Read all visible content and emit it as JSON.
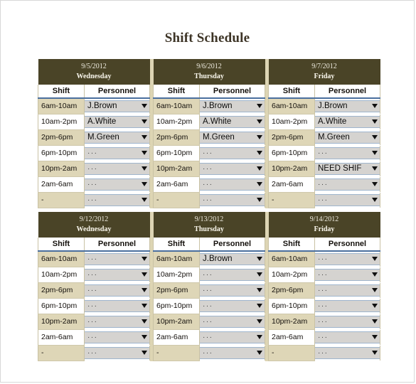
{
  "page": {
    "title": "Shift Schedule"
  },
  "columns": {
    "shift_label": "Shift",
    "personnel_label": "Personnel"
  },
  "empty_value": "···",
  "shift_slots": [
    "6am-10am",
    "10am-2pm",
    "2pm-6pm",
    "6pm-10pm",
    "10pm-2am",
    "2am-6am",
    "-"
  ],
  "weeks": [
    {
      "days": [
        {
          "date": "9/5/2012",
          "weekday": "Wednesday",
          "rows": [
            {
              "shift": "6am-10am",
              "personnel": "J.Brown"
            },
            {
              "shift": "10am-2pm",
              "personnel": "A.White"
            },
            {
              "shift": "2pm-6pm",
              "personnel": "M.Green"
            },
            {
              "shift": "6pm-10pm",
              "personnel": "···"
            },
            {
              "shift": "10pm-2am",
              "personnel": "···"
            },
            {
              "shift": "2am-6am",
              "personnel": "···"
            },
            {
              "shift": "-",
              "personnel": "···"
            }
          ]
        },
        {
          "date": "9/6/2012",
          "weekday": "Thursday",
          "rows": [
            {
              "shift": "6am-10am",
              "personnel": "J.Brown"
            },
            {
              "shift": "10am-2pm",
              "personnel": "A.White"
            },
            {
              "shift": "2pm-6pm",
              "personnel": "M.Green"
            },
            {
              "shift": "6pm-10pm",
              "personnel": "···"
            },
            {
              "shift": "10pm-2am",
              "personnel": "···"
            },
            {
              "shift": "2am-6am",
              "personnel": "···"
            },
            {
              "shift": "-",
              "personnel": "···"
            }
          ]
        },
        {
          "date": "9/7/2012",
          "weekday": "Friday",
          "rows": [
            {
              "shift": "6am-10am",
              "personnel": "J.Brown"
            },
            {
              "shift": "10am-2pm",
              "personnel": "A.White"
            },
            {
              "shift": "2pm-6pm",
              "personnel": "M.Green"
            },
            {
              "shift": "6pm-10pm",
              "personnel": "···"
            },
            {
              "shift": "10pm-2am",
              "personnel": "NEED SHIF"
            },
            {
              "shift": "2am-6am",
              "personnel": "···"
            },
            {
              "shift": "-",
              "personnel": "···"
            }
          ]
        }
      ]
    },
    {
      "days": [
        {
          "date": "9/12/2012",
          "weekday": "Wednesday",
          "rows": [
            {
              "shift": "6am-10am",
              "personnel": "···"
            },
            {
              "shift": "10am-2pm",
              "personnel": "···"
            },
            {
              "shift": "2pm-6pm",
              "personnel": "···"
            },
            {
              "shift": "6pm-10pm",
              "personnel": "···"
            },
            {
              "shift": "10pm-2am",
              "personnel": "···"
            },
            {
              "shift": "2am-6am",
              "personnel": "···"
            },
            {
              "shift": "-",
              "personnel": "···"
            }
          ]
        },
        {
          "date": "9/13/2012",
          "weekday": "Thursday",
          "rows": [
            {
              "shift": "6am-10am",
              "personnel": "J.Brown"
            },
            {
              "shift": "10am-2pm",
              "personnel": "···"
            },
            {
              "shift": "2pm-6pm",
              "personnel": "···"
            },
            {
              "shift": "6pm-10pm",
              "personnel": "···"
            },
            {
              "shift": "10pm-2am",
              "personnel": "···"
            },
            {
              "shift": "2am-6am",
              "personnel": "···"
            },
            {
              "shift": "-",
              "personnel": "···"
            }
          ]
        },
        {
          "date": "9/14/2012",
          "weekday": "Friday",
          "rows": [
            {
              "shift": "6am-10am",
              "personnel": "···"
            },
            {
              "shift": "10am-2pm",
              "personnel": "···"
            },
            {
              "shift": "2pm-6pm",
              "personnel": "···"
            },
            {
              "shift": "6pm-10pm",
              "personnel": "···"
            },
            {
              "shift": "10pm-2am",
              "personnel": "···"
            },
            {
              "shift": "2am-6am",
              "personnel": "···"
            },
            {
              "shift": "-",
              "personnel": "···"
            }
          ]
        }
      ]
    }
  ],
  "colors": {
    "header_olive": "#4a4427",
    "row_beige": "#ded6b7",
    "dropdown_grey": "#d5d3d0",
    "underline_blue": "#4a6f9e",
    "title_text": "#3d3426"
  }
}
